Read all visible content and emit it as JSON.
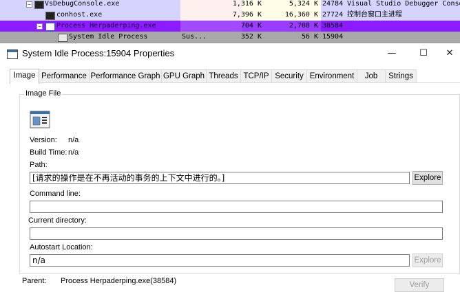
{
  "background_list": {
    "rows": [
      {
        "name": "VsDebugConsole.exe",
        "cpu": "",
        "private": "1,316 K",
        "working": "5,324 K",
        "pid": "24784",
        "description": "Visual Studio Debugger Conso",
        "style": "normal"
      },
      {
        "name": "conhost.exe",
        "cpu": "",
        "private": "7,396 K",
        "working": "16,360 K",
        "pid": "27724",
        "description": "控制台窗口主进程",
        "style": "normal"
      },
      {
        "name": "Process Herpaderping.exe",
        "cpu": "",
        "private": "704 K",
        "working": "2,708 K",
        "pid": "38584",
        "description": "",
        "style": "purple"
      },
      {
        "name": "System Idle Process",
        "cpu": "Sus...",
        "private": "352 K",
        "working": "56 K",
        "pid": "15904",
        "description": "",
        "style": "gray"
      }
    ]
  },
  "window": {
    "title": "System Idle Process:15904 Properties",
    "minimize_glyph": "—",
    "maximize_glyph": "☐",
    "close_glyph": "✕"
  },
  "tabs": [
    "Image",
    "Performance",
    "Performance Graph",
    "GPU Graph",
    "Threads",
    "TCP/IP",
    "Security",
    "Environment",
    "Job",
    "Strings"
  ],
  "active_tab": "Image",
  "image_file": {
    "group_label": "Image File",
    "version_label": "Version:",
    "version_value": "n/a",
    "build_time_label": "Build Time:",
    "build_time_value": "n/a",
    "path_label": "Path:",
    "path_value": "[请求的操作是在不再活动的事务的上下文中进行的。]",
    "explore_label": "Explore",
    "command_line_label": "Command line:",
    "command_line_value": "",
    "current_directory_label": "Current directory:",
    "current_directory_value": "",
    "autostart_label": "Autostart Location:",
    "autostart_value": "n/a",
    "autostart_explore_label": "Explore"
  },
  "parent": {
    "label": "Parent:",
    "value": "Process Herpaderping.exe(38584)"
  },
  "verify_label": "Verify",
  "colors": {
    "row_lavender": "#d4d4ff",
    "row_purple": "#8c1bff",
    "row_gray": "#a8a8a8",
    "private_col": "#fff0f0",
    "working_col": "#fffde8"
  }
}
